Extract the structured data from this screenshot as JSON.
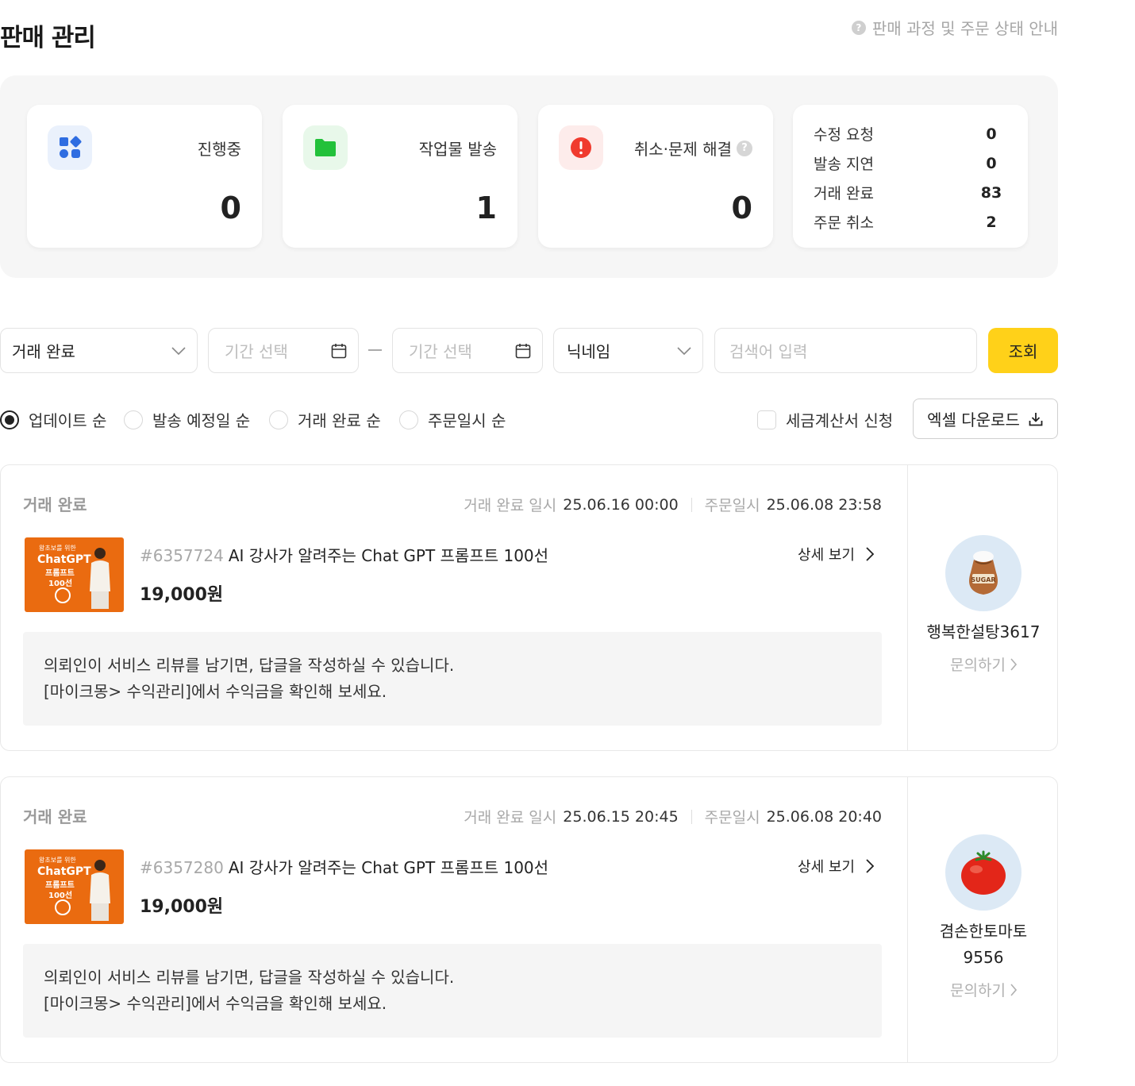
{
  "header": {
    "title": "판매 관리",
    "guide_link": "판매 과정 및 주문 상태 안내",
    "guide_icon": "question-icon"
  },
  "summary": {
    "cards": [
      {
        "label": "진행중",
        "value": "0",
        "icon": "grid-icon",
        "icon_color": "#2f6de1",
        "icon_bg": "#eaf1fc"
      },
      {
        "label": "작업물 발송",
        "value": "1",
        "icon": "folder-icon",
        "icon_color": "#22c13a",
        "icon_bg": "#e8f8ea"
      },
      {
        "label": "취소·문제 해결",
        "value": "0",
        "icon": "alert-icon",
        "icon_color": "#f03a2e",
        "icon_bg": "#fdeceb"
      }
    ],
    "mini": [
      {
        "label": "수정 요청",
        "value": "0"
      },
      {
        "label": "발송 지연",
        "value": "0"
      },
      {
        "label": "거래 완료",
        "value": "83"
      },
      {
        "label": "주문 취소",
        "value": "2"
      }
    ]
  },
  "filters": {
    "status_select": "거래 완료",
    "date_from_placeholder": "기간 선택",
    "date_to_placeholder": "기간 선택",
    "field_select": "닉네임",
    "search_placeholder": "검색어 입력",
    "search_button": "조회"
  },
  "sort": {
    "options": [
      "업데이트 순",
      "발송 예정일 순",
      "거래 완료 순",
      "주문일시 순"
    ],
    "selected_index": 0,
    "tax_label": "세금계산서 신청",
    "excel_button": "엑셀 다운로드"
  },
  "orders": [
    {
      "status": "거래 완료",
      "complete_label": "거래 완료 일시",
      "complete_value": "25.06.16 00:00",
      "order_label": "주문일시",
      "order_value": "25.06.08 23:58",
      "number": "#6357724",
      "title": "AI 강사가 알려주는 Chat GPT 프롬프트 100선",
      "price": "19,000원",
      "detail": "상세 보기",
      "message_1": "의뢰인이 서비스 리뷰를 남기면, 답글을 작성하실 수 있습니다.",
      "message_2": "[마이크몽> 수익관리]에서 수익금을 확인해 보세요.",
      "thumb_lines": [
        "왕초보를 위한",
        "ChatGPT",
        "프롬프트",
        "100선"
      ],
      "buyer_name": "행복한설탕3617",
      "buyer_avatar": "sugar-sack-icon",
      "ask": "문의하기"
    },
    {
      "status": "거래 완료",
      "complete_label": "거래 완료 일시",
      "complete_value": "25.06.15 20:45",
      "order_label": "주문일시",
      "order_value": "25.06.08 20:40",
      "number": "#6357280",
      "title": "AI 강사가 알려주는 Chat GPT 프롬프트 100선",
      "price": "19,000원",
      "detail": "상세 보기",
      "message_1": "의뢰인이 서비스 리뷰를 남기면, 답글을 작성하실 수 있습니다.",
      "message_2": "[마이크몽> 수익관리]에서 수익금을 확인해 보세요.",
      "thumb_lines": [
        "왕초보를 위한",
        "ChatGPT",
        "프롬프트",
        "100선"
      ],
      "buyer_name": "겸손한토마토9556",
      "buyer_avatar": "tomato-icon",
      "ask": "문의하기"
    }
  ],
  "colors": {
    "accent": "#ffd119",
    "highlight": "#ffef00"
  }
}
